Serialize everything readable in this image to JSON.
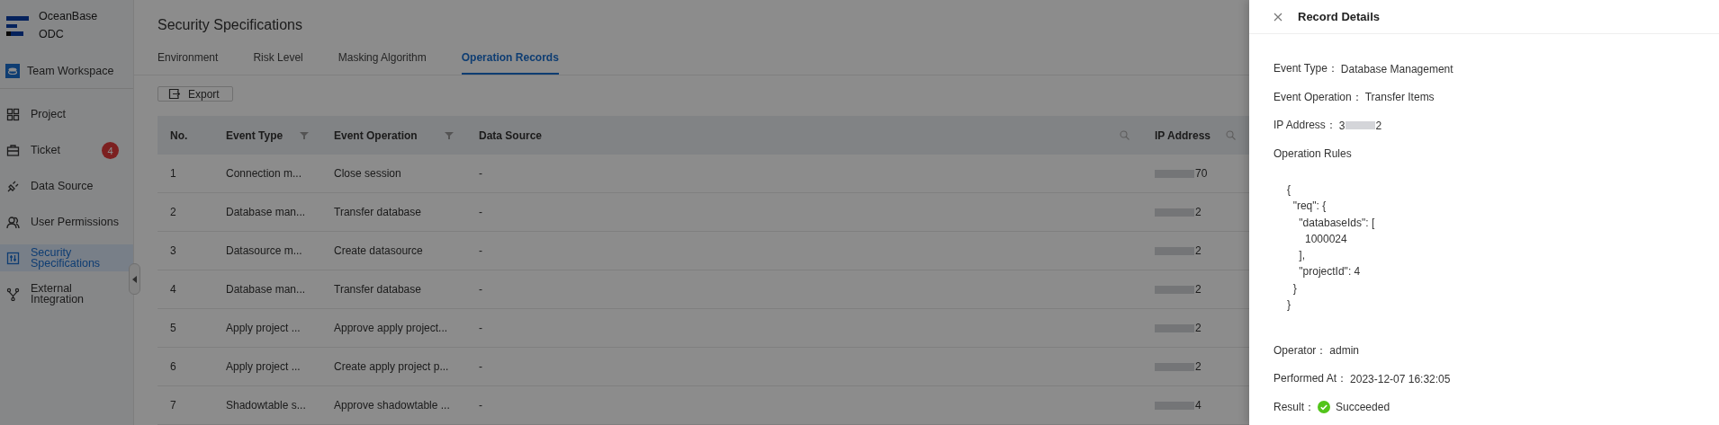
{
  "sidebar": {
    "logo": {
      "line_1": "OceanBase",
      "line_2": "ODC"
    },
    "workspace": "Team Workspace",
    "items": [
      {
        "kind": "grid",
        "label": "Project",
        "selected": false
      },
      {
        "kind": "ticket",
        "label": "Ticket",
        "selected": false,
        "badge": "4"
      },
      {
        "kind": "plug",
        "label": "Data Source",
        "selected": false
      },
      {
        "kind": "users",
        "label": "User Permissions",
        "selected": false
      },
      {
        "kind": "sliders",
        "label": "Security Specifications",
        "selected": true
      },
      {
        "kind": "fork",
        "label": "External Integration",
        "selected": false
      }
    ]
  },
  "page": {
    "title": "Security Specifications",
    "tabs": [
      {
        "label": "Environment",
        "selected": false
      },
      {
        "label": "Risk Level",
        "selected": false
      },
      {
        "label": "Masking Algorithm",
        "selected": false
      },
      {
        "label": "Operation Records",
        "selected": true
      }
    ],
    "export_button": "Export",
    "table": {
      "columns": [
        {
          "label": "No.",
          "kind": "plain"
        },
        {
          "label": "Event Type",
          "kind": "filter"
        },
        {
          "label": "Event Operation",
          "kind": "filter"
        },
        {
          "label": "Data Source",
          "kind": "search"
        },
        {
          "label": "IP Address",
          "kind": "search"
        }
      ],
      "rows": [
        {
          "no": "1",
          "event_type": "Connection m...",
          "event_operation": "Close session",
          "data_source": "-",
          "ip_address": "70"
        },
        {
          "no": "2",
          "event_type": "Database man...",
          "event_operation": "Transfer database",
          "data_source": "-",
          "ip_address": "2"
        },
        {
          "no": "3",
          "event_type": "Datasource m...",
          "event_operation": "Create datasource",
          "data_source": "-",
          "ip_address": "2"
        },
        {
          "no": "4",
          "event_type": "Database man...",
          "event_operation": "Transfer database",
          "data_source": "-",
          "ip_address": "2"
        },
        {
          "no": "5",
          "event_type": "Apply project ...",
          "event_operation": "Approve apply project...",
          "data_source": "-",
          "ip_address": "2"
        },
        {
          "no": "6",
          "event_type": "Apply project ...",
          "event_operation": "Create apply project p...",
          "data_source": "-",
          "ip_address": "2"
        },
        {
          "no": "7",
          "event_type": "Shadowtable s...",
          "event_operation": "Approve shadowtable ...",
          "data_source": "-",
          "ip_address": "4"
        }
      ]
    }
  },
  "drawer": {
    "title": "Record Details",
    "fields_top": [
      {
        "label": "Event Type：",
        "value": "Database Management"
      },
      {
        "label": "Event Operation：",
        "value": "Transfer Items"
      },
      {
        "label": "IP Address：",
        "value_prefix": "3",
        "value_suffix": "2"
      }
    ],
    "rules_label": "Operation Rules",
    "rules_code": "{\n  \"req\": {\n    \"databaseIds\": [\n      1000024\n    ],\n    \"projectId\": 4\n  }\n}",
    "fields_bottom": [
      {
        "label": "Operator：",
        "value": "admin"
      },
      {
        "label": "Performed At：",
        "value": "2023-12-07 16:32:05"
      },
      {
        "label": "Result：",
        "value": "Succeeded",
        "kind": "success"
      }
    ]
  }
}
